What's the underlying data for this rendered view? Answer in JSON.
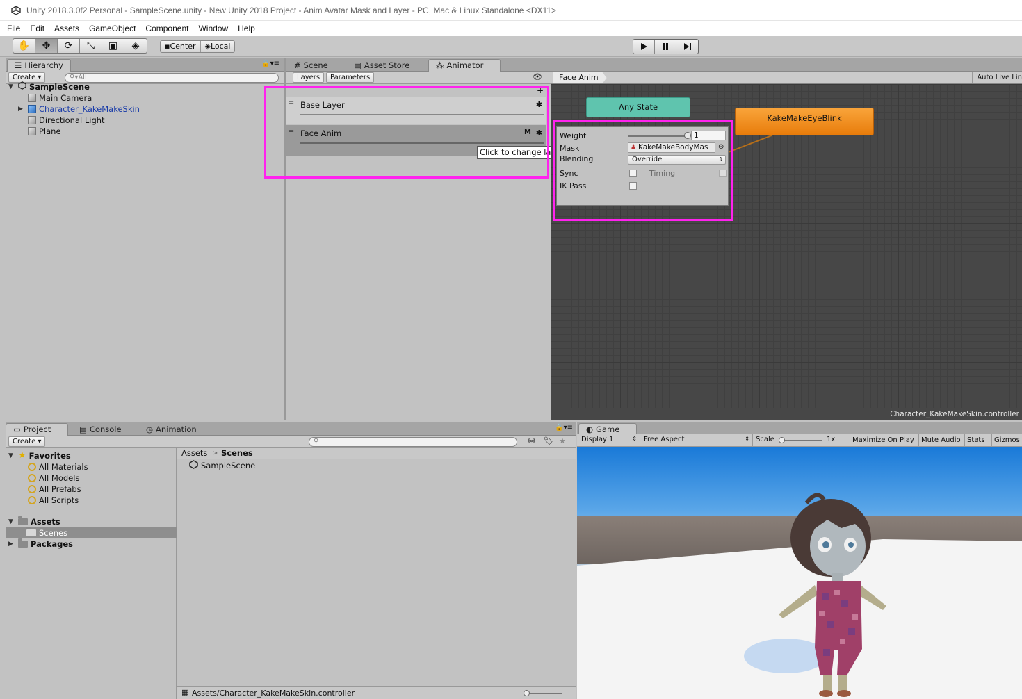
{
  "window_title": "Unity 2018.3.0f2 Personal - SampleScene.unity - New Unity 2018 Project - Anim Avatar Mask and Layer - PC, Mac & Linux Standalone <DX11>",
  "menu": [
    "File",
    "Edit",
    "Assets",
    "GameObject",
    "Component",
    "Window",
    "Help"
  ],
  "toolbar": {
    "pivot_center": "Center",
    "pivot_local": "Local"
  },
  "hierarchy": {
    "tab": "Hierarchy",
    "create": "Create",
    "search_placeholder": "All",
    "scene": "SampleScene",
    "items": [
      "Main Camera",
      "Character_KakeMakeSkin",
      "Directional Light",
      "Plane"
    ]
  },
  "center_tabs": [
    "Scene",
    "Asset Store",
    "Animator"
  ],
  "animator": {
    "subtabs": [
      "Layers",
      "Parameters"
    ],
    "breadcrumb": "Face Anim",
    "auto_live": "Auto Live Lin",
    "layers": [
      {
        "name": "Base Layer",
        "badge": ""
      },
      {
        "name": "Face Anim",
        "badge": "M"
      }
    ],
    "tooltip": "Click to change layer settings.",
    "settings": {
      "weight_label": "Weight",
      "weight_value": "1",
      "weight_fraction": 1,
      "mask_label": "Mask",
      "mask_value": "KakeMakeBodyMas",
      "blending_label": "Blending",
      "blending_value": "Override",
      "sync_label": "Sync",
      "timing_label": "Timing",
      "ikpass_label": "IK Pass"
    },
    "nodes": {
      "any_state": "Any State",
      "state": "KakeMakeEyeBlink"
    },
    "footer": "Character_KakeMakeSkin.controller"
  },
  "project": {
    "tabs": [
      "Project",
      "Console",
      "Animation"
    ],
    "create": "Create",
    "favorites_label": "Favorites",
    "favorites": [
      "All Materials",
      "All Models",
      "All Prefabs",
      "All Scripts"
    ],
    "assets_label": "Assets",
    "scenes_label": "Scenes",
    "packages_label": "Packages",
    "breadcrumb_root": "Assets",
    "breadcrumb_current": "Scenes",
    "files": [
      "SampleScene"
    ],
    "status_path": "Assets/Character_KakeMakeSkin.controller"
  },
  "game": {
    "tab": "Game",
    "display": "Display 1",
    "aspect": "Free Aspect",
    "scale_label": "Scale",
    "scale_value": "1x",
    "toggles": [
      "Maximize On Play",
      "Mute Audio",
      "Stats",
      "Gizmos"
    ]
  },
  "colors": {
    "highlight": "#ff22ee",
    "any_state": "#5fc4ae",
    "state_node": "#f28a16",
    "graph_bg": "#474747"
  }
}
